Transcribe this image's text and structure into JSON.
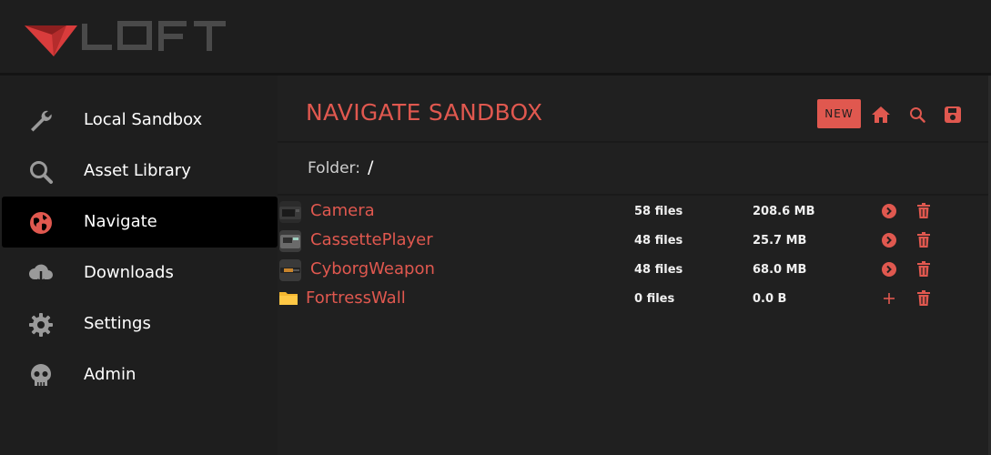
{
  "app": {
    "logo_text": "LOFT",
    "accent": "#e0584f"
  },
  "sidebar": {
    "items": [
      {
        "label": "Local Sandbox",
        "icon": "wrench-icon"
      },
      {
        "label": "Asset Library",
        "icon": "search-icon"
      },
      {
        "label": "Navigate",
        "icon": "globe-icon",
        "active": true
      },
      {
        "label": "Downloads",
        "icon": "cloud-download-icon"
      },
      {
        "label": "Settings",
        "icon": "gear-icon"
      },
      {
        "label": "Admin",
        "icon": "skull-icon"
      }
    ]
  },
  "main": {
    "title": "NAVIGATE SANDBOX",
    "new_label": "NEW",
    "folder_label": "Folder:",
    "folder_path": "/"
  },
  "rows": [
    {
      "name": "Camera",
      "files": "58 files",
      "size": "208.6 MB",
      "action_icon": "open-circle-icon"
    },
    {
      "name": "CassettePlayer",
      "files": "48 files",
      "size": "25.7 MB",
      "action_icon": "open-circle-icon"
    },
    {
      "name": "CyborgWeapon",
      "files": "48 files",
      "size": "68.0 MB",
      "action_icon": "open-circle-icon"
    },
    {
      "name": "FortressWall",
      "files": "0 files",
      "size": "0.0 B",
      "action_icon": "plus-icon"
    }
  ]
}
